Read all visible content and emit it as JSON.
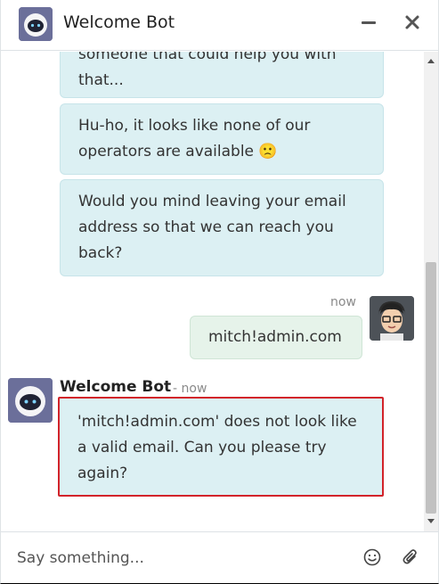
{
  "header": {
    "title": "Welcome Bot",
    "avatar_icon": "robot-avatar",
    "minimize_icon": "minimize-icon",
    "close_icon": "close-icon"
  },
  "messages": [
    {
      "from": "bot",
      "lines": [
        "someone that could help you with",
        "that..."
      ]
    },
    {
      "from": "bot",
      "lines": [
        "Hu-ho, it looks like none of our",
        "operators are available 🙁"
      ]
    },
    {
      "from": "bot",
      "lines": [
        "Would you mind leaving your email",
        "address so that we can reach you",
        "back?"
      ]
    },
    {
      "from": "user",
      "timestamp": "now",
      "lines": [
        "mitch!admin.com"
      ]
    },
    {
      "from": "bot",
      "author": "Welcome Bot",
      "timestamp": "- now",
      "lines": [
        "'mitch!admin.com' does not look like",
        "a valid email. Can you please try",
        "again?"
      ]
    }
  ],
  "composer": {
    "placeholder": "Say something...",
    "emoji_icon": "smiley-icon",
    "attach_icon": "paperclip-icon"
  },
  "colors": {
    "bot_bubble": "#dcf0f3",
    "user_bubble": "#e6f3ea",
    "highlight_border": "#d2232a",
    "bot_avatar_bg": "#6b6f9a"
  }
}
